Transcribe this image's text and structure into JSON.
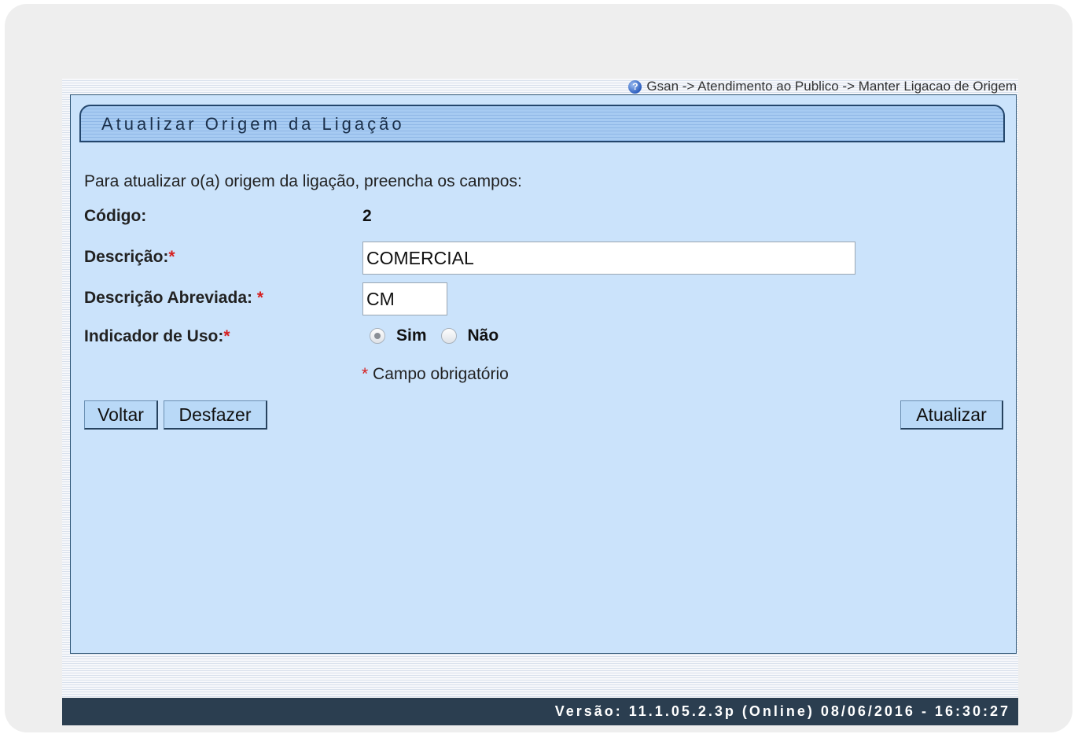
{
  "breadcrumb": {
    "text": "Gsan -> Atendimento ao Publico -> Manter Ligacao de Origem",
    "icon": "help-icon"
  },
  "form": {
    "title": "Atualizar Origem da Ligação",
    "instructions": "Para atualizar o(a) origem da ligação, preencha os campos:",
    "codigo": {
      "label": "Código:",
      "value": "2"
    },
    "descricao": {
      "label": "Descrição:",
      "required_mark": "*",
      "value": "COMERCIAL"
    },
    "descricao_abreviada": {
      "label": "Descrição Abreviada:",
      "required_mark": "*",
      "value": "CM"
    },
    "indicador_uso": {
      "label": "Indicador de Uso:",
      "required_mark": "*",
      "options": [
        {
          "label": "Sim",
          "checked": true
        },
        {
          "label": "Não",
          "checked": false
        }
      ]
    },
    "required_note": {
      "mark": "*",
      "text": "Campo obrigatório"
    }
  },
  "buttons": {
    "voltar": "Voltar",
    "desfazer": "Desfazer",
    "atualizar": "Atualizar"
  },
  "footer": {
    "version_text": "Versão: 11.1.05.2.3p (Online) 08/06/2016 - 16:30:27"
  },
  "colors": {
    "panel_bg": "#cbe3fb",
    "title_bar": "#a7cbf2",
    "footer_bg": "#2b3e50",
    "required": "#d62020"
  }
}
